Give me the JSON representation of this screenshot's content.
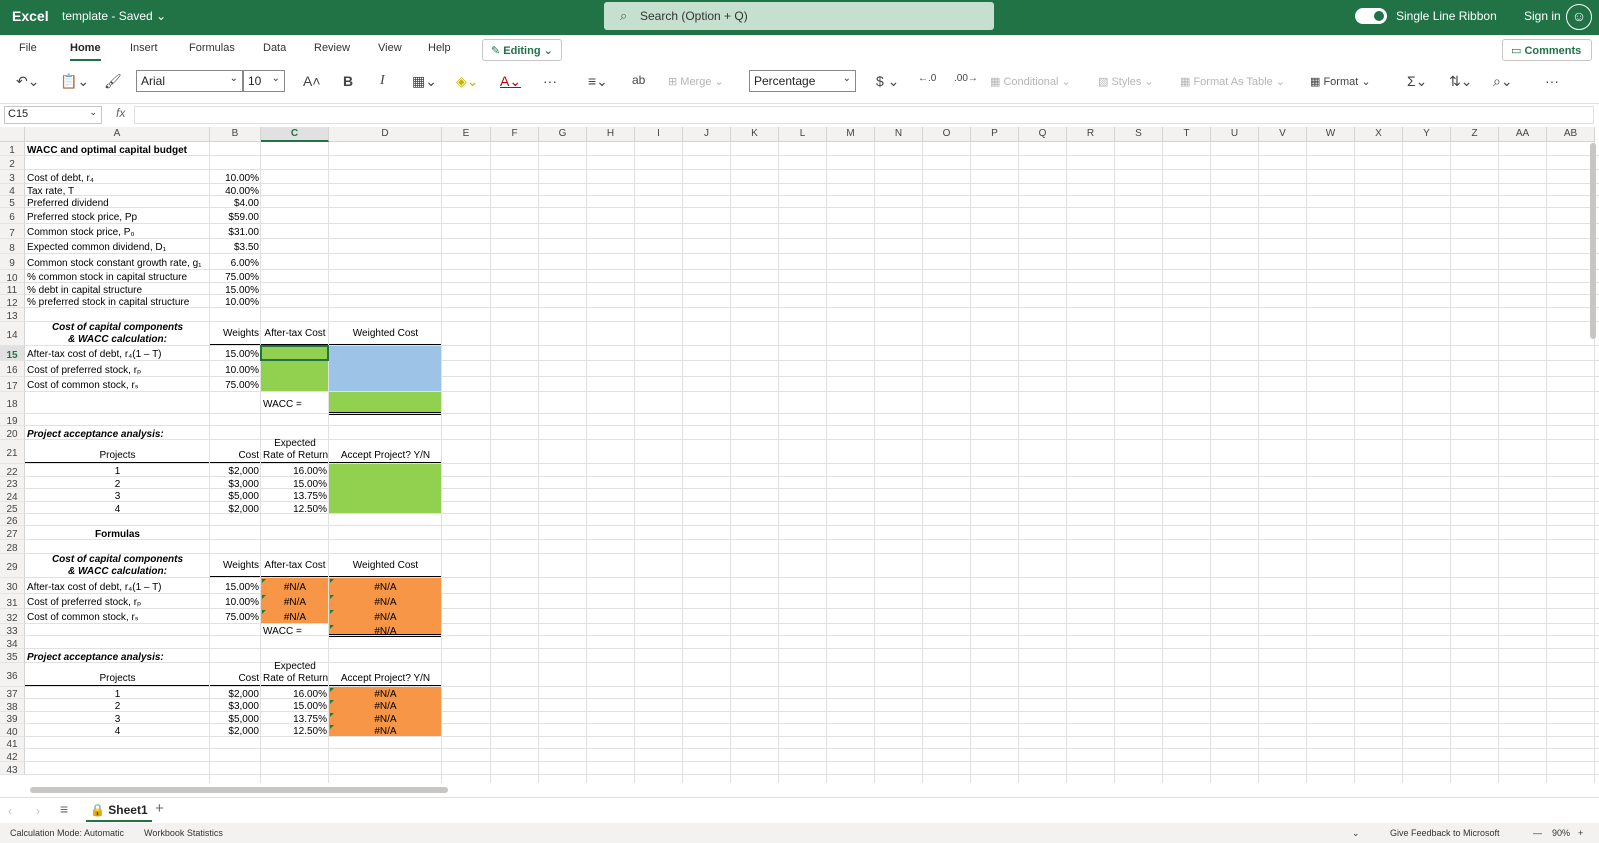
{
  "titlebar": {
    "app_name": "Excel",
    "doc_title": "template",
    "doc_status": "Saved",
    "search_placeholder": "Search (Option + Q)",
    "single_line_ribbon": "Single Line Ribbon",
    "sign_in": "Sign in"
  },
  "menu": {
    "tabs": [
      "File",
      "Home",
      "Insert",
      "Formulas",
      "Data",
      "Review",
      "View",
      "Help"
    ],
    "active_tab": "Home",
    "editing": "Editing",
    "comments": "Comments"
  },
  "ribbon": {
    "font_name": "Arial",
    "font_size": "10",
    "merge": "Merge",
    "number_format": "Percentage",
    "conditional": "Conditional",
    "styles": "Styles",
    "format_as_table": "Format As Table",
    "format": "Format",
    "more": "···"
  },
  "formula_bar": {
    "name_box": "C15",
    "fx": "fx",
    "content": ""
  },
  "columns": [
    "A",
    "B",
    "C",
    "D",
    "E",
    "F",
    "G",
    "H",
    "I",
    "J",
    "K",
    "L",
    "M",
    "N",
    "O",
    "P",
    "Q",
    "R",
    "S",
    "T",
    "U",
    "V",
    "W",
    "X",
    "Y",
    "Z",
    "AA",
    "AB"
  ],
  "rows": [
    "1",
    "2",
    "3",
    "4",
    "5",
    "6",
    "7",
    "8",
    "9",
    "10",
    "11",
    "12",
    "13",
    "14",
    "15",
    "16",
    "17",
    "18",
    "19",
    "20",
    "21",
    "22",
    "23",
    "24",
    "25",
    "26",
    "27",
    "28",
    "29",
    "30",
    "31",
    "32",
    "33",
    "34",
    "35",
    "36",
    "37",
    "38",
    "39",
    "40",
    "41",
    "42",
    "43"
  ],
  "selected_cell": {
    "column": "C",
    "row": "15"
  },
  "sheet": {
    "title": "WACC and optimal capital budget",
    "inputs": [
      {
        "label": "Cost of debt, r₄",
        "value": "10.00%"
      },
      {
        "label": "Tax rate, T",
        "value": "40.00%"
      },
      {
        "label": "Preferred dividend",
        "value": "$4.00"
      },
      {
        "label": "Preferred stock price, Pp",
        "value": "$59.00"
      },
      {
        "label": "Common stock price, P₀",
        "value": "$31.00"
      },
      {
        "label": "Expected common dividend, D₁",
        "value": "$3.50"
      },
      {
        "label": "Common stock constant growth rate, g₁",
        "value": "6.00%"
      },
      {
        "label": "% common stock in capital structure",
        "value": "75.00%"
      },
      {
        "label": "% debt in capital structure",
        "value": "15.00%"
      },
      {
        "label": "% preferred stock in capital structure",
        "value": "10.00%"
      }
    ],
    "section_cc_line1": "Cost of capital components",
    "section_cc_line2": "& WACC calculation:",
    "hdr_weights": "Weights",
    "hdr_aftertax": "After-tax Cost",
    "hdr_weighted": "Weighted Cost",
    "components": [
      {
        "label": "After-tax cost of debt, r₄(1 – T)",
        "weight": "15.00%"
      },
      {
        "label": "Cost of preferred stock, rₚ",
        "weight": "10.00%"
      },
      {
        "label": "Cost of common stock, rₛ",
        "weight": "75.00%"
      }
    ],
    "wacc_label": "WACC =",
    "project_section": "Project acceptance analysis:",
    "hdr_projects": "Projects",
    "hdr_cost": "Cost",
    "hdr_expected": "Expected",
    "hdr_ror": "Rate of Return",
    "hdr_accept": "Accept Project?  Y/N",
    "projects": [
      {
        "id": "1",
        "cost": "$2,000",
        "ror": "16.00%"
      },
      {
        "id": "2",
        "cost": "$3,000",
        "ror": "15.00%"
      },
      {
        "id": "3",
        "cost": "$5,000",
        "ror": "13.75%"
      },
      {
        "id": "4",
        "cost": "$2,000",
        "ror": "12.50%"
      }
    ],
    "formulas_label": "Formulas",
    "na": "#N/A"
  },
  "sheet_tabs": {
    "active": "Sheet1"
  },
  "status": {
    "calc_mode": "Calculation Mode: Automatic",
    "workbook_stats": "Workbook Statistics",
    "feedback": "Give Feedback to Microsoft",
    "zoom": "90%"
  },
  "colors": {
    "brand": "#217346",
    "green_fill": "#92d050",
    "blue_fill": "#9dc3e6",
    "orange_fill": "#f79646"
  }
}
